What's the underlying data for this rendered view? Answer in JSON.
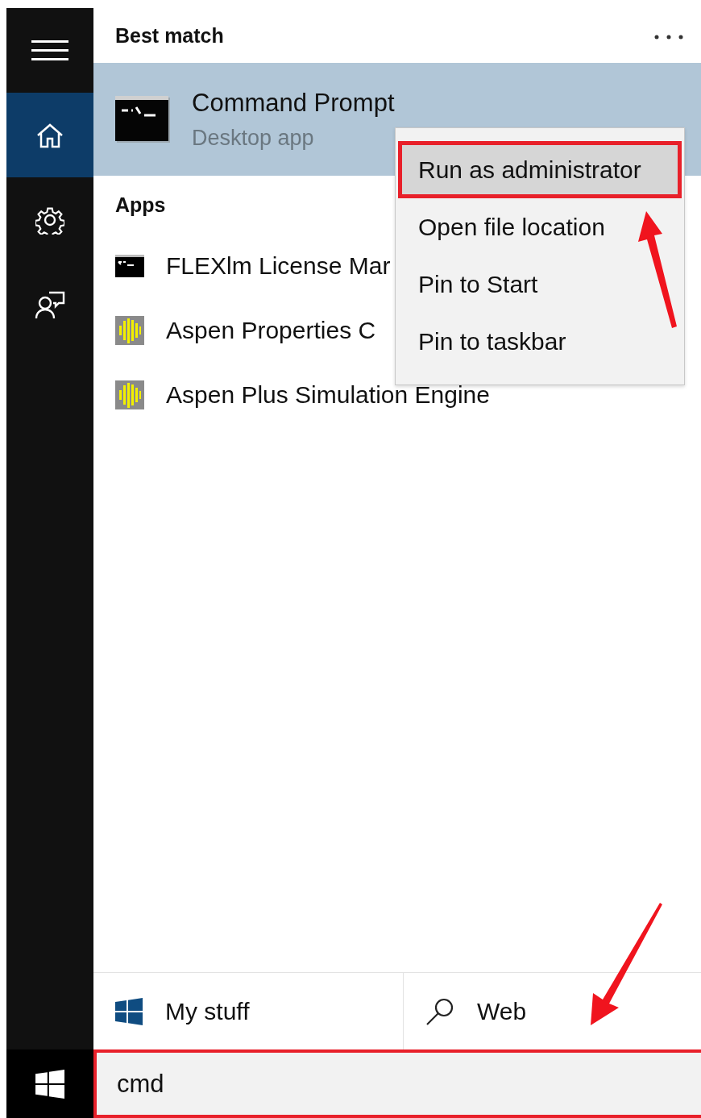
{
  "sidebar": {
    "items": [
      {
        "kind": "menu",
        "selected": false
      },
      {
        "kind": "home",
        "selected": true
      },
      {
        "kind": "settings",
        "selected": false
      },
      {
        "kind": "feedback",
        "selected": false
      }
    ]
  },
  "best_match": {
    "heading": "Best match",
    "item": {
      "name": "Command Prompt",
      "subtitle": "Desktop app",
      "selected": true
    }
  },
  "apps": {
    "heading": "Apps",
    "items": [
      {
        "name": "FLEXlm License Mar",
        "kind": "console"
      },
      {
        "name": "Aspen Properties C",
        "kind": "aspen"
      },
      {
        "name": "Aspen Plus Simulation Engine",
        "kind": "aspen"
      }
    ]
  },
  "context_menu": {
    "items": [
      {
        "label": "Run as administrator",
        "selected": true,
        "outlined": true
      },
      {
        "label": "Open file location",
        "selected": false,
        "outlined": false
      },
      {
        "label": "Pin to Start",
        "selected": false,
        "outlined": false
      },
      {
        "label": "Pin to taskbar",
        "selected": false,
        "outlined": false
      }
    ]
  },
  "scopes": [
    {
      "label": "My stuff",
      "kind": "windows"
    },
    {
      "label": "Web",
      "kind": "search"
    }
  ],
  "search": {
    "value": "cmd",
    "outlined": true
  }
}
